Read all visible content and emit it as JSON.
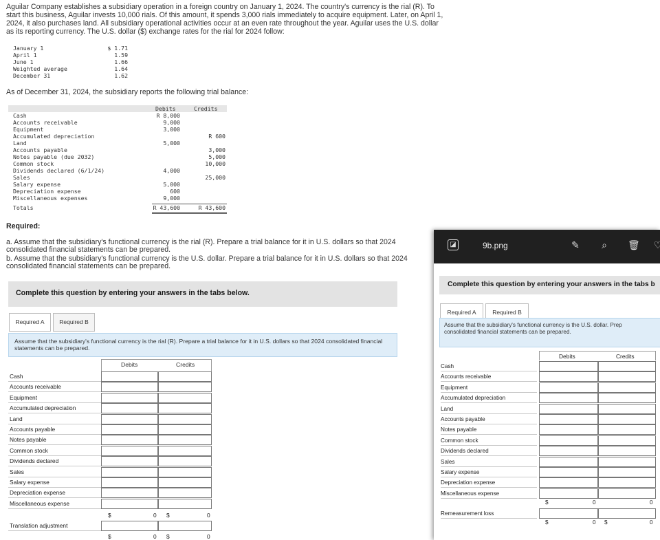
{
  "problem": {
    "intro": "Aguilar Company establishes a subsidiary operation in a foreign country on January 1, 2024. The country's currency is the rial (R). To start this business, Aguilar invests 10,000 rials. Of this amount, it spends 3,000 rials immediately to acquire equipment. Later, on April 1, 2024, it also purchases land. All subsidiary operational activities occur at an even rate throughout the year. Aguilar uses the U.S. dollar as its reporting currency. The U.S. dollar ($) exchange rates for the rial for 2024 follow:",
    "rates": [
      {
        "label": "January 1",
        "value": "$ 1.71"
      },
      {
        "label": "April 1",
        "value": "1.59"
      },
      {
        "label": "June 1",
        "value": "1.66"
      },
      {
        "label": "Weighted average",
        "value": "1.64"
      },
      {
        "label": "December 31",
        "value": "1.62"
      }
    ],
    "as_of": "As of December 31, 2024, the subsidiary reports the following trial balance:",
    "tb_headers": {
      "debits": "Debits",
      "credits": "Credits"
    },
    "tb_rows": [
      {
        "account": "Cash",
        "debit": "R 8,000",
        "credit": ""
      },
      {
        "account": "Accounts receivable",
        "debit": "9,000",
        "credit": ""
      },
      {
        "account": "Equipment",
        "debit": "3,000",
        "credit": ""
      },
      {
        "account": "Accumulated depreciation",
        "debit": "",
        "credit": "R 600"
      },
      {
        "account": "Land",
        "debit": "5,000",
        "credit": ""
      },
      {
        "account": "Accounts payable",
        "debit": "",
        "credit": "3,000"
      },
      {
        "account": "Notes payable (due 2032)",
        "debit": "",
        "credit": "5,000"
      },
      {
        "account": "Common stock",
        "debit": "",
        "credit": "10,000"
      },
      {
        "account": "Dividends declared (6/1/24)",
        "debit": "4,000",
        "credit": ""
      },
      {
        "account": "Sales",
        "debit": "",
        "credit": "25,000"
      },
      {
        "account": "Salary expense",
        "debit": "5,000",
        "credit": ""
      },
      {
        "account": "Depreciation expense",
        "debit": "600",
        "credit": ""
      },
      {
        "account": "Miscellaneous expenses",
        "debit": "9,000",
        "credit": ""
      }
    ],
    "tb_totals": {
      "label": "Totals",
      "debit": "R 43,600",
      "credit": "R 43,600"
    },
    "required_title": "Required:",
    "required_a": "a. Assume that the subsidiary's functional currency is the rial (R). Prepare a trial balance for it in U.S. dollars so that 2024 consolidated financial statements can be prepared.",
    "required_b": "b. Assume that the subsidiary's functional currency is the U.S. dollar. Prepare a trial balance for it in U.S. dollars so that 2024 consolidated financial statements can be prepared."
  },
  "answer": {
    "panel_header": "Complete this question by entering your answers in the tabs below.",
    "tabs": [
      "Required A",
      "Required B"
    ],
    "instruction": "Assume that the subsidiary's functional currency is the rial (R). Prepare a trial balance for it in U.S. dollars so that 2024 consolidated financial statements can be prepared.",
    "col_debits": "Debits",
    "col_credits": "Credits",
    "rows": [
      "Cash",
      "Accounts receivable",
      "Equipment",
      "Accumulated depreciation",
      "Land",
      "Accounts payable",
      "Notes payable",
      "Common stock",
      "Dividends declared",
      "Sales",
      "Salary expense",
      "Depreciation expense",
      "Miscellaneous expense"
    ],
    "subtotal": {
      "cur1": "$",
      "debit": "0",
      "cur2": "$",
      "credit": "0"
    },
    "adjust_label": "Translation adjustment",
    "total": {
      "cur1": "$",
      "debit": "0",
      "cur2": "$",
      "credit": "0"
    }
  },
  "viewer": {
    "filename": "9b.png",
    "panel_header": "Complete this question by entering your answers in the tabs b",
    "tabs": [
      "Required A",
      "Required B"
    ],
    "instruction": "Assume that the subsidiary's functional currency is the U.S. dollar. Prep\nconsolidated financial statements can be prepared.",
    "col_debits": "Debits",
    "col_credits": "Credits",
    "rows": [
      "Cash",
      "Accounts receivable",
      "Equipment",
      "Accumulated depreciation",
      "Land",
      "Accounts payable",
      "Notes payable",
      "Common stock",
      "Dividends declared",
      "Sales",
      "Salary expense",
      "Depreciation expense",
      "Miscellaneous expense"
    ],
    "subtotal": {
      "cur1": "$",
      "debit": "0",
      "credit": "0"
    },
    "remeasure_label": "Remeasurement loss",
    "total": {
      "cur1": "$",
      "debit": "0",
      "cur2": "$",
      "credit": "0"
    }
  }
}
